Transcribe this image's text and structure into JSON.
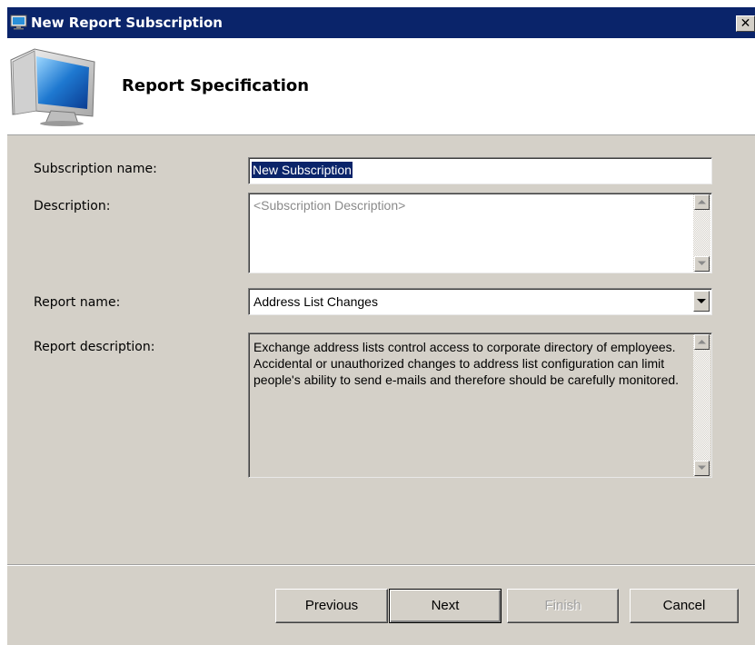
{
  "window": {
    "title": "New Report Subscription",
    "close_glyph": "✕"
  },
  "banner": {
    "title": "Report Specification",
    "icon": "computer-monitor-icon"
  },
  "form": {
    "subscription_name_label": "Subscription name:",
    "subscription_name_value": "New Subscription",
    "description_label": "Description:",
    "description_placeholder": "<Subscription Description>",
    "report_name_label": "Report name:",
    "report_name_value": "Address List Changes",
    "report_description_label": "Report description:",
    "report_description_value": "Exchange address lists control access to corporate directory of employees. Accidental or unauthorized changes to address list configuration can limit people's ability to send e-mails and therefore should be carefully monitored."
  },
  "buttons": {
    "previous": "Previous",
    "next": "Next",
    "finish": "Finish",
    "cancel": "Cancel"
  },
  "colors": {
    "title_bar": "#0a246a",
    "dialog_face": "#d4d0c8",
    "selection": "#0a246a"
  }
}
